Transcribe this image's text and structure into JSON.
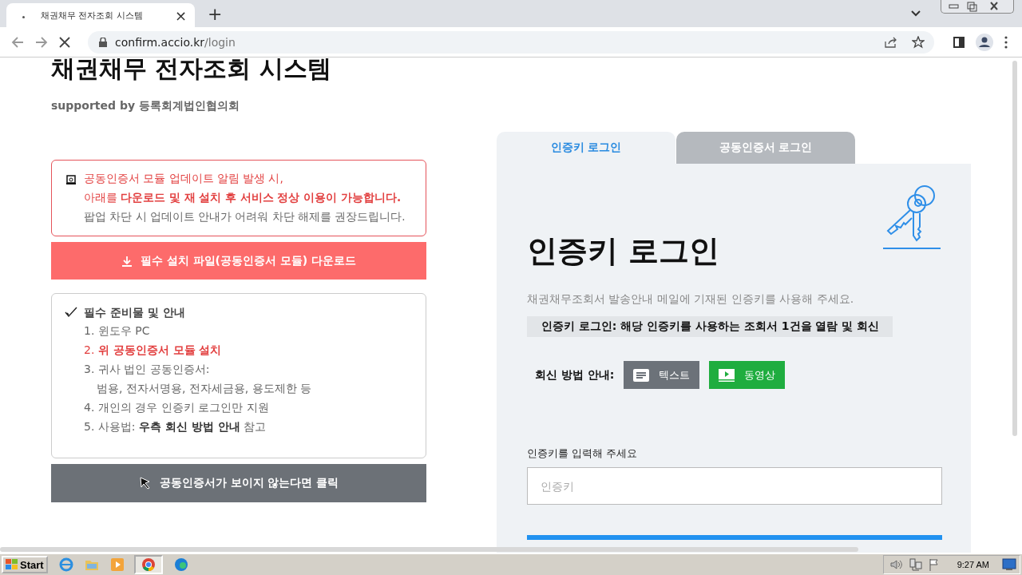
{
  "browser": {
    "tab": {
      "title": "채권채무 전자조회 시스템",
      "close": "×"
    },
    "new_tab": "+",
    "url": {
      "host": "confirm.accio.kr",
      "path": "/login"
    }
  },
  "page": {
    "title": "채권채무 전자조회 시스템",
    "subtitle": "supported by 등록회계법인협의회",
    "notice": {
      "lines": [
        {
          "text": "공동인증서 모듈 업데이트 알림 발생 시,",
          "kind": "alert"
        },
        {
          "text": "아래를 **다운로드 및 재 설치 후 서비스 정상 이용이 가능합니다.**",
          "kind": "alert"
        },
        {
          "text": "팝업 차단 시 업데이트 안내가 어려워 차단 해제를 권장드립니다.",
          "kind": "plain"
        }
      ]
    },
    "download_button": "필수 설치 파일(공동인증서 모듈) 다운로드",
    "checklist": {
      "title": "필수 준비물 및 안내",
      "items": [
        {
          "text": "1. 윈도우 PC",
          "highlight": false
        },
        {
          "text": "2. **위 공동인증서 모듈 설치**",
          "highlight": true
        },
        {
          "text": "3. 귀사 법인 공동인증서:",
          "detail": "범용, 전자서명용, 전자세금용, 용도제한 등",
          "highlight": false
        },
        {
          "text": "4. 개인의 경우 인증키 로그인만 지원",
          "highlight": false
        },
        {
          "text": "5. 사용법: **우측 회신 방법 안내** 참고",
          "highlight": false
        }
      ]
    },
    "cert_help_button": "공동인증서가 보이지 않는다면 클릭",
    "login": {
      "tabs": [
        {
          "label": "인증키 로그인",
          "selected": true
        },
        {
          "label": "공동인증서 로그인",
          "selected": false
        }
      ],
      "heading": "인증키 로그인",
      "description": "채권채무조회서 발송안내 메일에 기재된 인증키를 사용해 주세요.",
      "info": "인증키 로그인: 해당 인증키를 사용하는 조회서 1건을 열람 및 회신",
      "guide_label": "회신 방법 안내:",
      "guide_buttons": [
        {
          "label": "텍스트",
          "kind": "text"
        },
        {
          "label": "동영상",
          "kind": "video"
        }
      ],
      "field_label": "인증키를 입력해 주세요",
      "field": {
        "placeholder": "인증키"
      }
    }
  },
  "taskbar": {
    "start": "Start",
    "time": "9:27 AM"
  }
}
